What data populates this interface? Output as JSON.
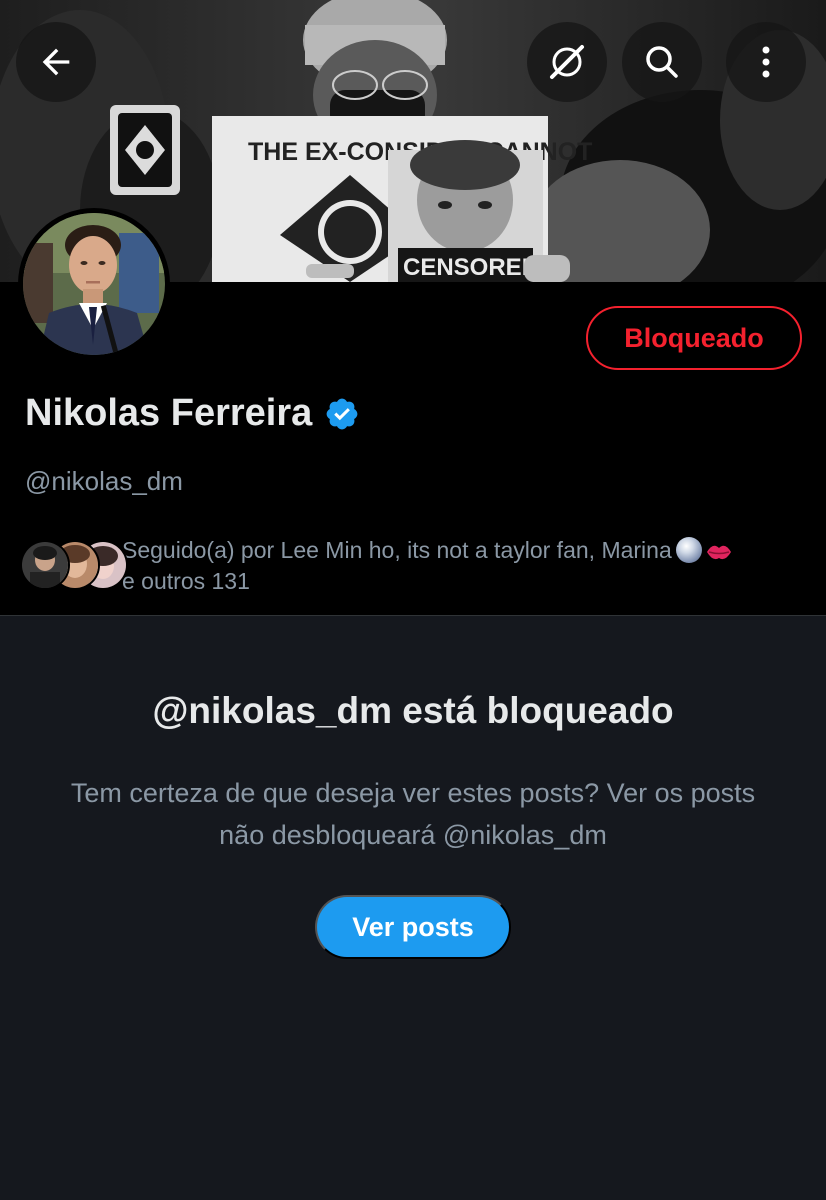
{
  "header": {
    "back_icon": "arrow-left-icon",
    "grok_icon": "grok-icon",
    "search_icon": "search-icon",
    "more_icon": "more-vertical-icon"
  },
  "banner": {
    "sign_text": "THE EX-CONSIDER CANNOT",
    "poster_text": "CENSORED"
  },
  "profile": {
    "block_button_label": "Bloqueado",
    "display_name": "Nikolas Ferreira",
    "handle": "@nikolas_dm",
    "followed_by_text": "Seguido(a) por Lee Min ho, its not a taylor fan, Marina",
    "followed_by_more": "e outros 131"
  },
  "notice": {
    "title": "@nikolas_dm está bloqueado",
    "body": "Tem certeza de que deseja ver estes posts? Ver os posts não desbloqueará @nikolas_dm",
    "button_label": "Ver posts"
  },
  "colors": {
    "accent": "#1d9bf0",
    "danger": "#f4212e",
    "secondary_text": "#8b98a5",
    "background": "#15181e"
  }
}
